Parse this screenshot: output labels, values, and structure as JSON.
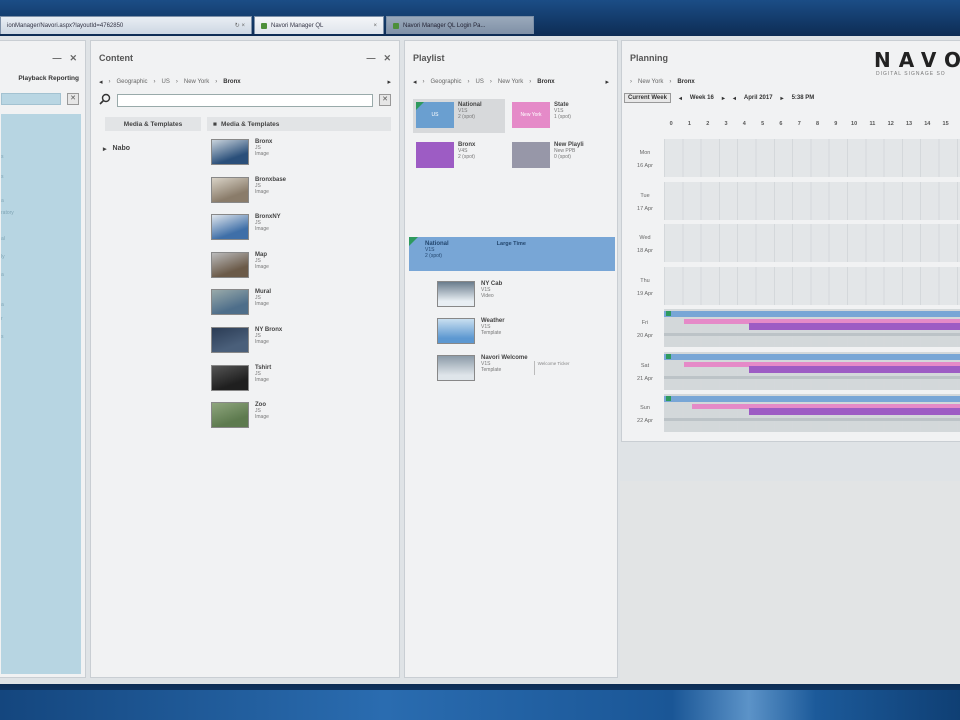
{
  "browser": {
    "url_fragment": "ionManager/Navori.aspx?layoutId=4762850",
    "tabs": [
      {
        "title": "Navori Manager QL",
        "state": "active"
      },
      {
        "title": "Navori Manager QL Login Pa...",
        "state": "inactive"
      }
    ]
  },
  "left_panel": {
    "tab_label": "Playback Reporting",
    "list_words": [
      "s",
      "s",
      "a",
      "ratory",
      "al",
      "ly",
      "a",
      "a",
      "r",
      "s"
    ]
  },
  "content_panel": {
    "title": "Content",
    "breadcrumbs": [
      "Geographic",
      "US",
      "New York",
      "Bronx"
    ],
    "section_left": "Media & Templates",
    "section_right": "Media & Templates",
    "folder": "Nabo",
    "media": [
      {
        "name": "Bronx",
        "sub": "JS",
        "type": "Image"
      },
      {
        "name": "Bronxbase",
        "sub": "JS",
        "type": "Image"
      },
      {
        "name": "BronxNY",
        "sub": "JS",
        "type": "Image"
      },
      {
        "name": "Map",
        "sub": "JS",
        "type": "Image"
      },
      {
        "name": "Mural",
        "sub": "JS",
        "type": "Image"
      },
      {
        "name": "NY Bronx",
        "sub": "JS",
        "type": "Image"
      },
      {
        "name": "Tshirt",
        "sub": "JS",
        "type": "Image"
      },
      {
        "name": "Zoo",
        "sub": "JS",
        "type": "Image"
      }
    ]
  },
  "playlist_panel": {
    "title": "Playlist",
    "breadcrumbs": [
      "Geographic",
      "US",
      "New York",
      "Bronx"
    ],
    "tiles": [
      {
        "name": "National",
        "sub": "V1S",
        "count": "2 (spot)",
        "label": "US",
        "color": "#6a9fd0",
        "selected": true
      },
      {
        "name": "State",
        "sub": "V1S",
        "count": "1 (spot)",
        "label": "New York",
        "color": "#e58ac8",
        "selected": false
      },
      {
        "name": "Bronx",
        "sub": "V4S",
        "count": "2 (spot)",
        "label": "",
        "color": "#9d5cc4",
        "selected": false
      },
      {
        "name": "New Playli",
        "sub": "New PPB",
        "count": "0 (spot)",
        "label": "",
        "color": "#9797a8",
        "selected": false
      }
    ],
    "banner": {
      "name": "National",
      "sub": "V1S",
      "count": "2 (spot)",
      "right": "Large Time"
    },
    "items": [
      {
        "name": "NY Cab",
        "sub": "V1S",
        "type": "Video",
        "note": ""
      },
      {
        "name": "Weather",
        "sub": "V1S",
        "type": "Template",
        "note": ""
      },
      {
        "name": "Navori Welcome",
        "sub": "V1S",
        "type": "Template",
        "note": "Welcome Ticker"
      }
    ]
  },
  "planning_panel": {
    "title": "Planning",
    "breadcrumbs": [
      "New York",
      "Bronx"
    ],
    "current_week": "Current Week",
    "week": "Week 16",
    "month": "April 2017",
    "time": "5:38 PM",
    "hours": [
      "0",
      "1",
      "2",
      "3",
      "4",
      "5",
      "6",
      "7",
      "8",
      "9",
      "10",
      "11",
      "12",
      "13",
      "14",
      "15"
    ],
    "days": [
      {
        "name": "Mon",
        "date": "16 Apr"
      },
      {
        "name": "Tue",
        "date": "17 Apr"
      },
      {
        "name": "Wed",
        "date": "18 Apr"
      },
      {
        "name": "Thu",
        "date": "19 Apr"
      },
      {
        "name": "Fri",
        "date": "20 Apr"
      },
      {
        "name": "Sat",
        "date": "21 Apr"
      },
      {
        "name": "Sun",
        "date": "22 Apr"
      }
    ],
    "logo": "NAVO",
    "logo_sub": "DIGITAL SIGNAGE SO"
  }
}
